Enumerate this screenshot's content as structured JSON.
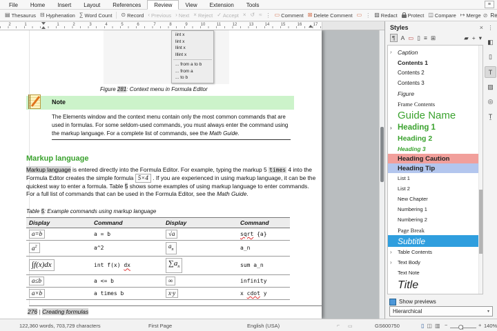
{
  "colors": {
    "heading_green": "#3aa22e",
    "caution_bg": "#f19f9b",
    "tip_bg": "#b3c6ee",
    "selection_blue": "#2f9ede",
    "note_green": "#ccf3ca",
    "highlight_gray": "#d4d4d4"
  },
  "icons": {
    "hamburger": "≡",
    "close": "×",
    "overflow": "⋮",
    "dropdown": "▾"
  },
  "menubar": {
    "tabs": [
      {
        "label": "File"
      },
      {
        "label": "Home"
      },
      {
        "label": "Insert"
      },
      {
        "label": "Layout"
      },
      {
        "label": "References"
      },
      {
        "label": "Review",
        "active": true
      },
      {
        "label": "View"
      },
      {
        "label": "Extension"
      },
      {
        "label": "Tools"
      }
    ]
  },
  "toolbar": {
    "items": [
      {
        "name": "thesaurus",
        "icon": "▤",
        "label": "Thesaurus"
      },
      {
        "name": "hyphenation",
        "icon": "⊟",
        "label": "Hyphenation"
      },
      {
        "name": "word-count",
        "icon": "∑",
        "label": "Word Count"
      },
      {
        "sep": true
      },
      {
        "name": "record-changes",
        "icon": "⊙",
        "label": "Record"
      },
      {
        "name": "previous-change",
        "icon": "‹",
        "label": "Previous",
        "disabled": true
      },
      {
        "name": "next-change",
        "icon": "›",
        "label": "Next",
        "disabled": true
      },
      {
        "name": "reject-change",
        "icon": "×",
        "label": "Reject",
        "disabled": true
      },
      {
        "name": "accept-change",
        "icon": "✓",
        "label": "Accept",
        "disabled": true
      },
      {
        "name": "reject-all",
        "icon": "×",
        "disabled": true
      },
      {
        "name": "undo-change",
        "icon": "↺",
        "disabled": true
      },
      {
        "name": "show-changes",
        "icon": "≈",
        "disabled": true
      },
      {
        "dots": true
      },
      {
        "name": "comment",
        "icon": "▭",
        "label": "Comment",
        "orange": true
      },
      {
        "name": "delete-comment",
        "icon": "⊠",
        "label": "Delete Comment",
        "orange": true
      },
      {
        "name": "comment-extra",
        "icon": "▭",
        "orange": true,
        "disabled": true
      },
      {
        "dots": true
      },
      {
        "name": "redact",
        "icon": "▨",
        "label": "Redact"
      },
      {
        "name": "protect",
        "icon": "lock",
        "label": "Protect"
      },
      {
        "name": "compare",
        "icon": "◫",
        "label": "Compare"
      },
      {
        "name": "merge",
        "icon": "↦",
        "label": "Merge"
      }
    ],
    "right": {
      "icon": "⊘",
      "label": "Review",
      "arrow": "▾"
    }
  },
  "ruler": {
    "labels": [
      "2",
      "1",
      "1",
      "2",
      "3",
      "4",
      "5",
      "6",
      "7",
      "8",
      "9",
      "10",
      "11",
      "12",
      "13",
      "14",
      "15",
      "16",
      "17"
    ]
  },
  "document": {
    "figure": {
      "menu_group1": [
        "iint x",
        "lint x",
        "llint x",
        "lllint x"
      ],
      "menu_group2": [
        "... from a to b",
        "... from a",
        "... to b"
      ],
      "caption_prefix": "Figure ",
      "caption_num": "281",
      "caption_rest": ": Context menu in Formula Editor"
    },
    "note": {
      "title": "Note",
      "body_main": "The Elements window and the context menu contain only the most common commands that are used in formulas. For some seldom-used commands, you must always enter the command using the markup language. For a complete list of commands, see the ",
      "body_italic": "Math Guide",
      "body_end": "."
    },
    "heading": "Markup language",
    "para": {
      "p1_hl": "Markup language",
      "p1": " is entered directly into the Formula Editor. For example, typing the markup 5 ",
      "p_times": "times",
      "p2": " 4 into the Formula Editor creates the simple formula ",
      "p_fbox": "5×4",
      "p3": " . If you are experienced in using markup language, it can be the quickest way to enter a formula. Table ",
      "p_5": "5",
      "p4": " shows some examples of using markup language to enter commands. For a full list of commands that can be used in the Formula Editor, see the ",
      "p_guide": "Math Guide",
      "p5": "."
    },
    "table_caption": {
      "prefix": "Table ",
      "num": "5",
      "rest": ": Example commands using markup language"
    },
    "table": {
      "headers": [
        "Display",
        "Command",
        "Display",
        "Command"
      ],
      "rows": [
        {
          "d1": [
            {
              "t": "a=b"
            }
          ],
          "c1": [
            {
              "t": "a = b"
            }
          ],
          "d2": [
            {
              "t": "√a"
            }
          ],
          "c2": [
            {
              "t": "sqrt",
              "s": "err"
            },
            {
              "t": " {a}"
            }
          ]
        },
        {
          "d1": [
            {
              "t": "a"
            },
            {
              "t": "2",
              "s": "sup"
            }
          ],
          "c1": [
            {
              "t": "a^2"
            }
          ],
          "d2": [
            {
              "t": "a"
            },
            {
              "t": "n",
              "s": "sub"
            }
          ],
          "c2": [
            {
              "t": "a_n"
            }
          ]
        },
        {
          "big": true,
          "d1": [
            {
              "t": "∫f(x)dx"
            }
          ],
          "c1": [
            {
              "t": "int f(x) "
            },
            {
              "t": "dx",
              "s": "err"
            }
          ],
          "d2": [
            {
              "t": "∑a"
            },
            {
              "t": "n",
              "s": "sub"
            }
          ],
          "c2": [
            {
              "t": "sum a_n"
            }
          ]
        },
        {
          "d1": [
            {
              "t": "a≤b"
            }
          ],
          "c1": [
            {
              "t": "a <= b"
            }
          ],
          "d2": [
            {
              "t": "∞"
            }
          ],
          "c2": [
            {
              "t": "infinity"
            }
          ]
        },
        {
          "d1": [
            {
              "t": "a×b"
            }
          ],
          "c1": [
            {
              "t": "a times b"
            }
          ],
          "d2": [
            {
              "t": "x·y"
            }
          ],
          "c2": [
            {
              "t": "x "
            },
            {
              "t": "cdot",
              "s": "err"
            },
            {
              "t": " y"
            }
          ]
        }
      ]
    },
    "footer": {
      "page_num": "276",
      "sep": "|",
      "title": "Creating formulas"
    }
  },
  "styles_panel": {
    "title": "Styles",
    "toolbar_icons": [
      {
        "name": "paragraph-styles",
        "glyph": "¶",
        "selected": true
      },
      {
        "name": "character-styles",
        "glyph": "A"
      },
      {
        "name": "frame-styles",
        "glyph": "▭",
        "red": true
      },
      {
        "name": "page-styles",
        "glyph": "▯"
      },
      {
        "name": "list-styles",
        "glyph": "≡"
      },
      {
        "name": "table-styles",
        "glyph": "⊞"
      },
      {
        "spacer": true
      },
      {
        "name": "fill-format-mode",
        "glyph": "▰"
      },
      {
        "name": "new-style",
        "glyph": "+"
      },
      {
        "name": "style-actions",
        "glyph": "▾"
      }
    ],
    "list": [
      {
        "label": "Caption",
        "cls": "it",
        "chev": true
      },
      {
        "label": "Contents 1",
        "cls": "b"
      },
      {
        "label": "Contents 2",
        "cls": ""
      },
      {
        "label": "Contents 3",
        "cls": ""
      },
      {
        "label": "Figure",
        "cls": "it"
      },
      {
        "label": "Frame Contents",
        "cls": "serif"
      },
      {
        "label": "Guide Name",
        "cls": "guide"
      },
      {
        "label": "Heading 1",
        "cls": "h1",
        "chev": true
      },
      {
        "label": "Heading 2",
        "cls": "h2"
      },
      {
        "label": "Heading 3",
        "cls": "h3"
      },
      {
        "label": "Heading Caution",
        "cls": "caution"
      },
      {
        "label": "Heading Tip",
        "cls": "tip"
      },
      {
        "label": "List 1",
        "cls": "sm"
      },
      {
        "label": "List 2",
        "cls": "sm"
      },
      {
        "label": "New Chapter",
        "cls": "sm"
      },
      {
        "label": "Numbering 1",
        "cls": "sm"
      },
      {
        "label": "Numbering 2",
        "cls": "sm"
      },
      {
        "label": "Page Break",
        "cls": "serif"
      },
      {
        "label": "Subtitle",
        "cls": "subtitle",
        "selected": true
      },
      {
        "label": "Table Contents",
        "cls": "sm",
        "chev": true
      },
      {
        "label": "Text Body",
        "cls": "sm",
        "chev": true
      },
      {
        "label": "Text Note",
        "cls": "sm"
      },
      {
        "label": "Title",
        "cls": "title"
      }
    ],
    "show_previews": "Show previews",
    "filter_value": "Hierarchical",
    "strip_icons": [
      {
        "name": "sidebar-menu",
        "glyph": "⋮",
        "menu": true
      },
      {
        "name": "properties-deck",
        "glyph": "◧"
      },
      {
        "name": "page-deck",
        "glyph": "▯"
      },
      {
        "name": "styles-deck",
        "glyph": "T",
        "selected": true
      },
      {
        "name": "gallery-deck",
        "glyph": "▨"
      },
      {
        "name": "navigator-deck",
        "glyph": "◎"
      },
      {
        "name": "inspector-deck",
        "glyph": "Ṯ"
      }
    ]
  },
  "statusbar": {
    "word_count": "122,360 words, 703,729 characters",
    "page_style": "First Page",
    "language": "English (USA)",
    "doc_id": "GS600750",
    "zoom_minus": "−",
    "zoom_plus": "+",
    "zoom_percent": "140%",
    "view_icons": [
      {
        "name": "single-page-view",
        "glyph": "▯",
        "active": true
      },
      {
        "name": "multi-page-view",
        "glyph": "◫"
      },
      {
        "name": "book-view",
        "glyph": "▥"
      }
    ]
  }
}
